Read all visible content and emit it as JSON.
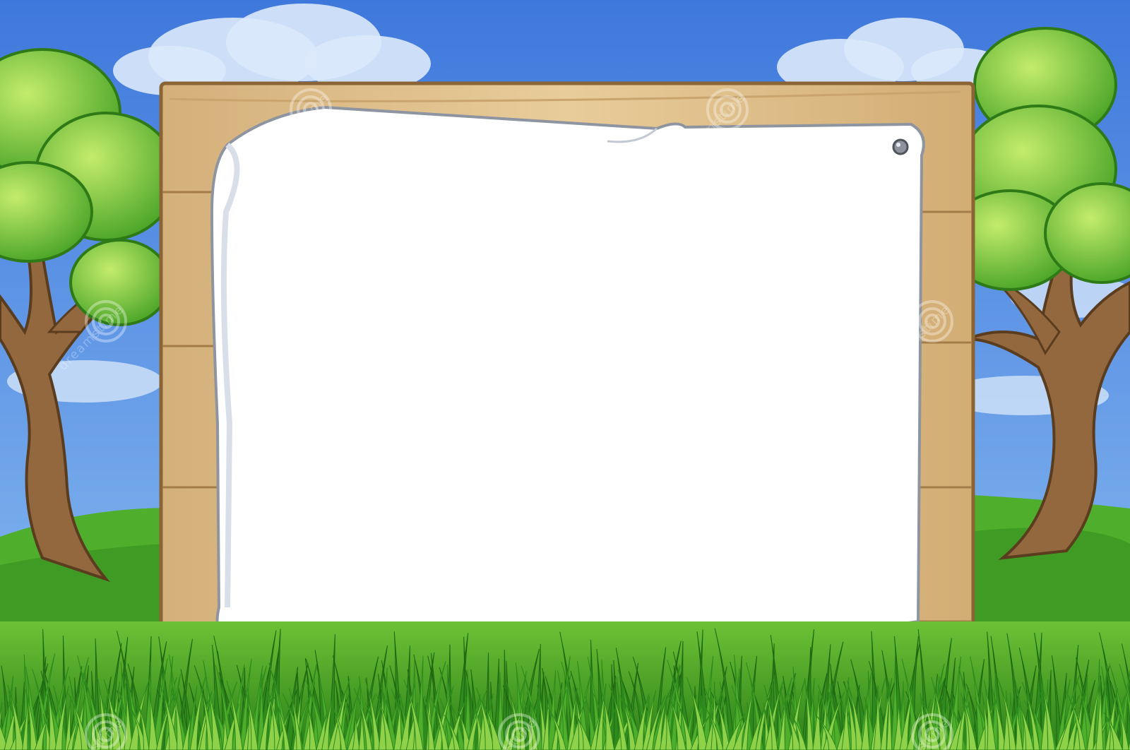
{
  "scene": {
    "description_icon": "cartoon-landscape-illustration",
    "sky_color_top": "#3f78dc",
    "sky_color_bottom": "#8cbff2",
    "cloud_color": "#dbe9fb",
    "hill_color": "#4fae2c",
    "grass_light": "#8fd24a",
    "grass_dark": "#2f8a1e",
    "wood_color": "#e2c38f",
    "wood_dark": "#a47c48",
    "paper_color": "#ffffff",
    "paper_shade": "#d9dfe8",
    "foliage_light": "#a8dd4f",
    "foliage_dark": "#3f9a22",
    "trunk_color": "#93683e"
  },
  "sign": {
    "icon": "wooden-sign-icon",
    "paper_icon": "blank-paper-icon",
    "pin_icon": "pushpin-icon"
  },
  "trees": {
    "left_icon": "tree-icon",
    "right_icon": "tree-icon"
  },
  "watermark": {
    "text": "dreamstime",
    "icon": "dreamstime-swirl-icon"
  }
}
